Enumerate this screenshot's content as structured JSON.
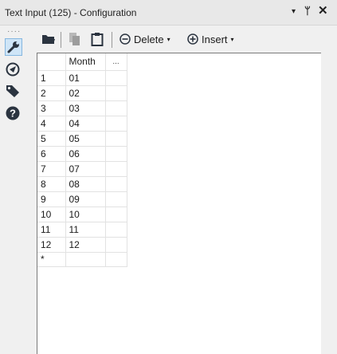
{
  "window": {
    "title": "Text Input (125) - Configuration",
    "menu_glyph": "▾",
    "pin_glyph": "ᛘ",
    "close_glyph": "✕"
  },
  "sidebar": {
    "grip": "····",
    "items": [
      {
        "icon": "wrench-icon",
        "active": true
      },
      {
        "icon": "compass-icon",
        "active": false
      },
      {
        "icon": "tag-icon",
        "active": false
      },
      {
        "icon": "help-icon",
        "active": false
      }
    ]
  },
  "toolbar": {
    "delete_label": "Delete",
    "insert_label": "Insert",
    "dropdown_glyph": "▾"
  },
  "grid": {
    "columns": [
      "Month",
      "..."
    ],
    "rows": [
      {
        "index": "1",
        "month": "01"
      },
      {
        "index": "2",
        "month": "02"
      },
      {
        "index": "3",
        "month": "03"
      },
      {
        "index": "4",
        "month": "04"
      },
      {
        "index": "5",
        "month": "05"
      },
      {
        "index": "6",
        "month": "06"
      },
      {
        "index": "7",
        "month": "07"
      },
      {
        "index": "8",
        "month": "08"
      },
      {
        "index": "9",
        "month": "09"
      },
      {
        "index": "10",
        "month": "10"
      },
      {
        "index": "11",
        "month": "11"
      },
      {
        "index": "12",
        "month": "12"
      }
    ],
    "new_row_marker": "*"
  },
  "colors": {
    "accent": "#86b7e0",
    "icon_dark": "#2b3440"
  }
}
